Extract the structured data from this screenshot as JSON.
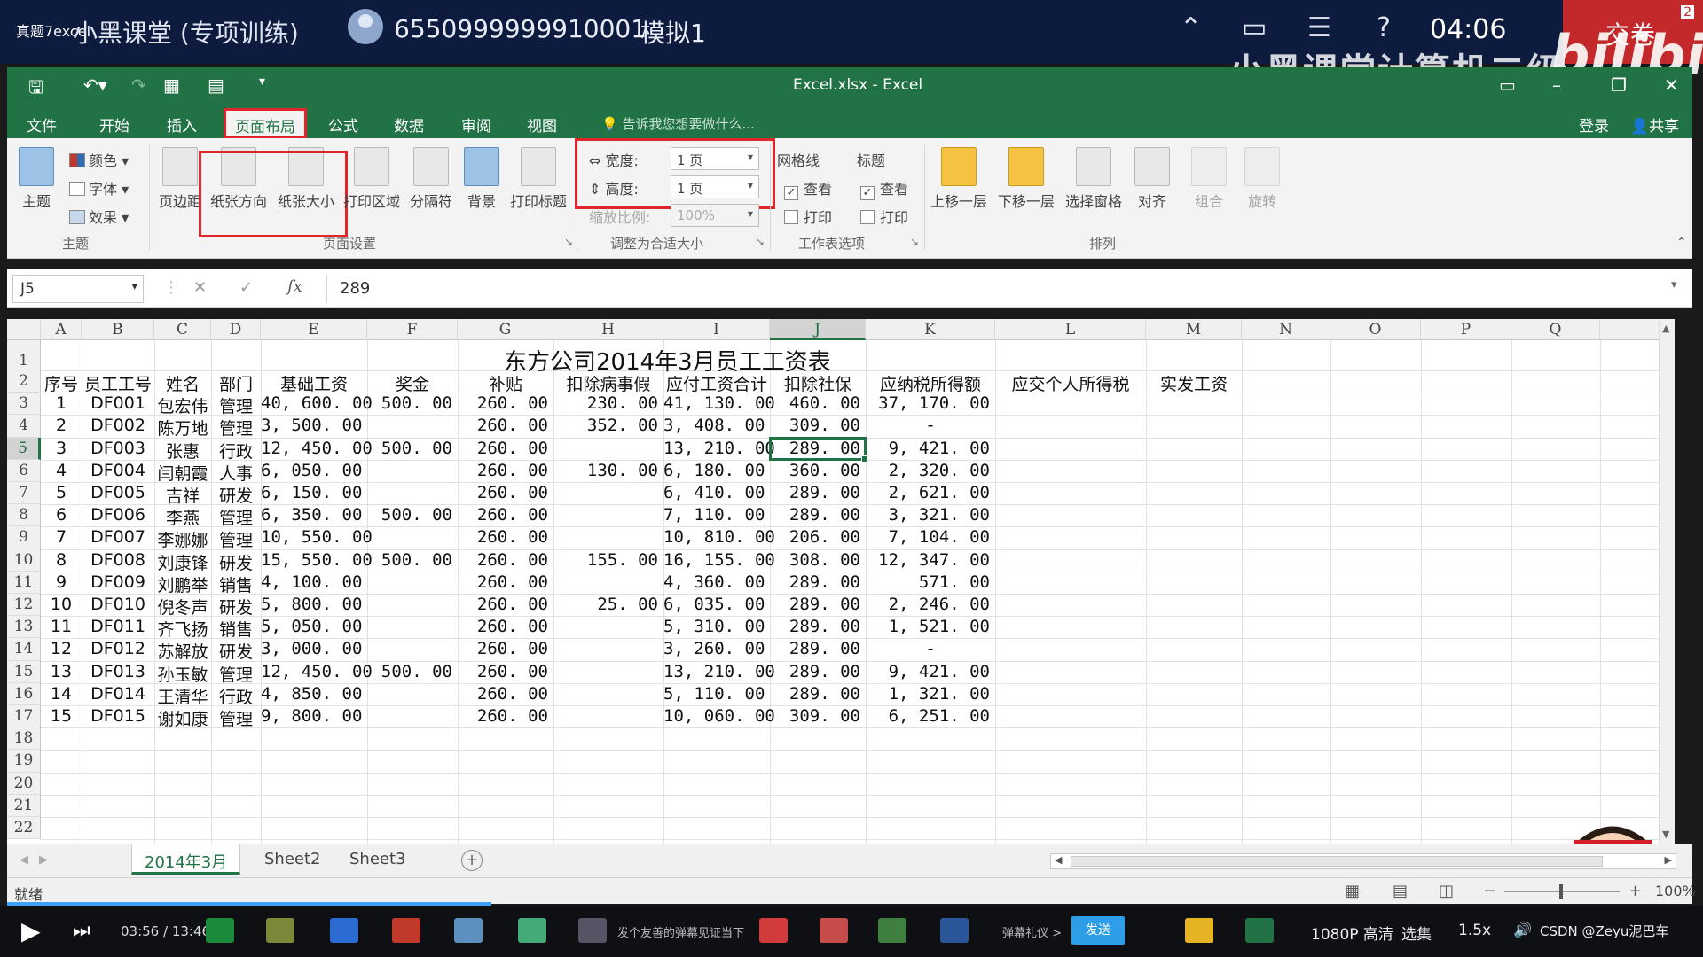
{
  "exam": {
    "caption": "真题7excel",
    "course": "小黑课堂 (专项训练)",
    "exam_id": "6550999999910001",
    "mock": "模拟1",
    "time": "04:06",
    "submit": "交卷",
    "badge": "2",
    "watermark": "小黑课堂计算机二级",
    "bilibili": "bilibili"
  },
  "excel": {
    "window_title": "Excel.xlsx - Excel",
    "tabs": [
      "文件",
      "开始",
      "插入",
      "页面布局",
      "公式",
      "数据",
      "审阅",
      "视图"
    ],
    "active_tab": "页面布局",
    "tell_me": "告诉我您想要做什么...",
    "login": "登录",
    "share": "共享"
  },
  "ribbon": {
    "theme": {
      "main": "主题",
      "colors": "颜色",
      "fonts": "字体",
      "effects": "效果",
      "group": "主题"
    },
    "page_setup": {
      "margins": "页边距",
      "orientation": "纸张方向",
      "size": "纸张大小",
      "print_area": "打印区域",
      "breaks": "分隔符",
      "background": "背景",
      "print_titles": "打印标题",
      "group": "页面设置"
    },
    "scale": {
      "width_label": "宽度:",
      "width_value": "1 页",
      "height_label": "高度:",
      "height_value": "1 页",
      "scale_label": "缩放比例:",
      "scale_value": "100%",
      "group": "调整为合适大小"
    },
    "sheet_options": {
      "gridlines": "网格线",
      "headings": "标题",
      "view": "查看",
      "print": "打印",
      "group": "工作表选项"
    },
    "arrange": {
      "bring_forward": "上移一层",
      "send_backward": "下移一层",
      "selection_pane": "选择窗格",
      "align": "对齐",
      "group_btn": "组合",
      "rotate": "旋转",
      "group": "排列"
    }
  },
  "formula": {
    "name_box": "J5",
    "value": "289"
  },
  "sheet": {
    "columns": [
      "A",
      "B",
      "C",
      "D",
      "E",
      "F",
      "G",
      "H",
      "I",
      "J",
      "K",
      "L",
      "M",
      "N",
      "O",
      "P",
      "Q"
    ],
    "selected_column": "J",
    "selected_row": 5,
    "title": "东方公司2014年3月员工工资表",
    "headers": [
      "序号",
      "员工工号",
      "姓名",
      "部门",
      "基础工资",
      "奖金",
      "补贴",
      "扣除病事假",
      "应付工资合计",
      "扣除社保",
      "应纳税所得额",
      "应交个人所得税",
      "实发工资"
    ],
    "rows": [
      [
        "1",
        "DF001",
        "包宏伟",
        "管理",
        "40, 600. 00",
        "500. 00",
        "260. 00",
        "230. 00",
        "41, 130. 00",
        "460. 00",
        "37, 170. 00"
      ],
      [
        "2",
        "DF002",
        "陈万地",
        "管理",
        "3, 500. 00",
        "",
        "260. 00",
        "352. 00",
        "3, 408. 00",
        "309. 00",
        "-"
      ],
      [
        "3",
        "DF003",
        "张惠",
        "行政",
        "12, 450. 00",
        "500. 00",
        "260. 00",
        "",
        "13, 210. 00",
        "289. 00",
        "9, 421. 00"
      ],
      [
        "4",
        "DF004",
        "闫朝霞",
        "人事",
        "6, 050. 00",
        "",
        "260. 00",
        "130. 00",
        "6, 180. 00",
        "360. 00",
        "2, 320. 00"
      ],
      [
        "5",
        "DF005",
        "吉祥",
        "研发",
        "6, 150. 00",
        "",
        "260. 00",
        "",
        "6, 410. 00",
        "289. 00",
        "2, 621. 00"
      ],
      [
        "6",
        "DF006",
        "李燕",
        "管理",
        "6, 350. 00",
        "500. 00",
        "260. 00",
        "",
        "7, 110. 00",
        "289. 00",
        "3, 321. 00"
      ],
      [
        "7",
        "DF007",
        "李娜娜",
        "管理",
        "10, 550. 00",
        "",
        "260. 00",
        "",
        "10, 810. 00",
        "206. 00",
        "7, 104. 00"
      ],
      [
        "8",
        "DF008",
        "刘康锋",
        "研发",
        "15, 550. 00",
        "500. 00",
        "260. 00",
        "155. 00",
        "16, 155. 00",
        "308. 00",
        "12, 347. 00"
      ],
      [
        "9",
        "DF009",
        "刘鹏举",
        "销售",
        "4, 100. 00",
        "",
        "260. 00",
        "",
        "4, 360. 00",
        "289. 00",
        "571. 00"
      ],
      [
        "10",
        "DF010",
        "倪冬声",
        "研发",
        "5, 800. 00",
        "",
        "260. 00",
        "25. 00",
        "6, 035. 00",
        "289. 00",
        "2, 246. 00"
      ],
      [
        "11",
        "DF011",
        "齐飞扬",
        "销售",
        "5, 050. 00",
        "",
        "260. 00",
        "",
        "5, 310. 00",
        "289. 00",
        "1, 521. 00"
      ],
      [
        "12",
        "DF012",
        "苏解放",
        "研发",
        "3, 000. 00",
        "",
        "260. 00",
        "",
        "3, 260. 00",
        "289. 00",
        "-"
      ],
      [
        "13",
        "DF013",
        "孙玉敏",
        "管理",
        "12, 450. 00",
        "500. 00",
        "260. 00",
        "",
        "13, 210. 00",
        "289. 00",
        "9, 421. 00"
      ],
      [
        "14",
        "DF014",
        "王清华",
        "行政",
        "4, 850. 00",
        "",
        "260. 00",
        "",
        "5, 110. 00",
        "289. 00",
        "1, 321. 00"
      ],
      [
        "15",
        "DF015",
        "谢如康",
        "管理",
        "9, 800. 00",
        "",
        "260. 00",
        "",
        "10, 060. 00",
        "309. 00",
        "6, 251. 00"
      ]
    ],
    "row_numbers": [
      "1",
      "2",
      "3",
      "4",
      "5",
      "6",
      "7",
      "8",
      "9",
      "10",
      "11",
      "12",
      "13",
      "14",
      "15",
      "16",
      "17",
      "18",
      "19",
      "20",
      "21",
      "22"
    ],
    "tabs": [
      "2014年3月",
      "Sheet2",
      "Sheet3"
    ],
    "active_tab": "2014年3月"
  },
  "status": {
    "ready": "就绪",
    "zoom": "100%"
  },
  "player": {
    "time": "03:56 / 13:46",
    "danmaku_hint": "发个友善的弹幕见证当下",
    "danmaku_etiquette": "弹幕礼仪 >",
    "send": "发送",
    "quality": "1080P 高清",
    "episodes": "选集",
    "speed": "1.5x",
    "csdn": "CSDN @Zeyu泥巴车"
  },
  "colors": {
    "excel_green": "#217346",
    "highlight_red": "#e0262a",
    "exam_navy": "#0d1b3e"
  }
}
